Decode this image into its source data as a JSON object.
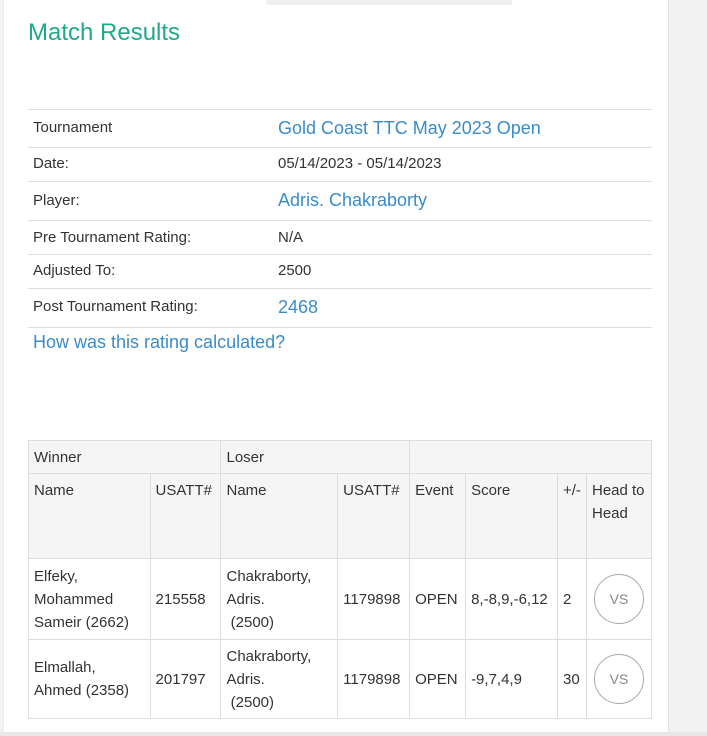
{
  "page": {
    "title": "Match Results"
  },
  "info": {
    "tournament_label": "Tournament",
    "tournament_value": "Gold Coast TTC May 2023 Open",
    "date_label": "Date:",
    "date_value": "05/14/2023 - 05/14/2023",
    "player_label": "Player:",
    "player_value": "Adris. Chakraborty",
    "pre_rating_label": "Pre Tournament Rating:",
    "pre_rating_value": "N/A",
    "adjusted_label": "Adjusted To:",
    "adjusted_value": "2500",
    "post_rating_label": "Post Tournament Rating:",
    "post_rating_value": "2468"
  },
  "calc_link": "How was this rating calculated?",
  "table": {
    "group_winner": "Winner",
    "group_loser": "Loser",
    "headers": {
      "winner_name": "Name",
      "winner_usatt": "USATT#",
      "loser_name": "Name",
      "loser_usatt": "USATT#",
      "event": "Event",
      "score": "Score",
      "plus_minus": "+/-",
      "head_to_head": "Head to Head"
    },
    "rows": [
      {
        "winner_name": "Elfeky, Mohammed Sameir (2662)",
        "winner_usatt": "215558",
        "loser_name": "Chakraborty, Adris.",
        "loser_rating": "(2500)",
        "loser_usatt": "1179898",
        "event": "OPEN",
        "score": "8,-8,9,-6,12",
        "plus_minus": "2",
        "vs": "VS"
      },
      {
        "winner_name": "Elmallah, Ahmed (2358)",
        "winner_usatt": "201797",
        "loser_name": "Chakraborty, Adris.",
        "loser_rating": "(2500)",
        "loser_usatt": "1179898",
        "event": "OPEN",
        "score": "-9,7,4,9",
        "plus_minus": "30",
        "vs": "VS"
      }
    ]
  }
}
